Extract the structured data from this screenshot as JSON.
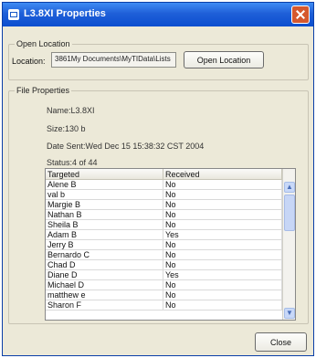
{
  "window": {
    "title": "L3.8XI Properties"
  },
  "open_location": {
    "group_title": "Open Location",
    "location_label": "Location:",
    "location_value": "3861My Documents\\MyTIData\\Lists",
    "open_button": "Open Location"
  },
  "file_properties": {
    "group_title": "File Properties",
    "name": "Name:L3.8XI",
    "size": "Size:130 b",
    "date_sent": "Date Sent:Wed Dec 15 15:38:32 CST 2004",
    "status": "Status:4 of 44"
  },
  "table": {
    "columns": [
      "Targeted",
      "Received"
    ],
    "rows": [
      [
        "Alene B",
        "No"
      ],
      [
        "val b",
        "No"
      ],
      [
        "Margie B",
        "No"
      ],
      [
        "Nathan B",
        "No"
      ],
      [
        "Sheila B",
        "No"
      ],
      [
        "Adam B",
        "Yes"
      ],
      [
        "Jerry B",
        "No"
      ],
      [
        "Bernardo C",
        "No"
      ],
      [
        "Chad D",
        "No"
      ],
      [
        "Diane D",
        "Yes"
      ],
      [
        "Michael D",
        "No"
      ],
      [
        "matthew e",
        "No"
      ],
      [
        "Sharon F",
        "No"
      ]
    ]
  },
  "footer": {
    "close_button": "Close"
  }
}
